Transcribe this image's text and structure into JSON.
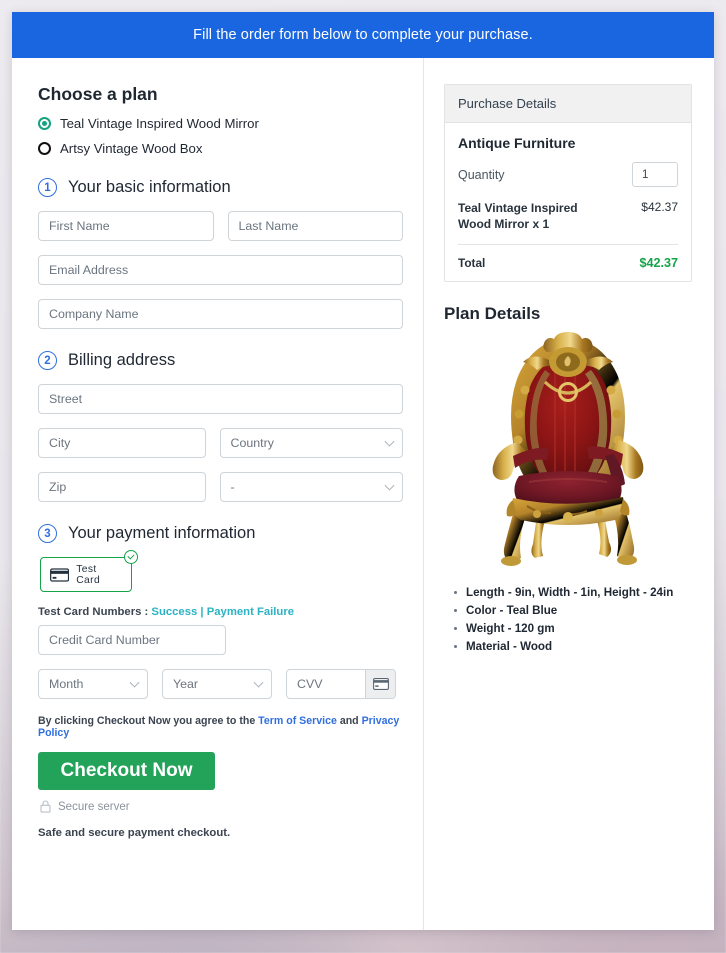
{
  "banner": {
    "text": "Fill the order form below to complete your purchase."
  },
  "plan": {
    "heading": "Choose a plan",
    "options": [
      {
        "label": "Teal Vintage Inspired Wood Mirror",
        "selected": true
      },
      {
        "label": "Artsy Vintage Wood Box",
        "selected": false
      }
    ]
  },
  "steps": {
    "basic": {
      "number": "1",
      "title": "Your basic information"
    },
    "billing": {
      "number": "2",
      "title": "Billing address"
    },
    "payment": {
      "number": "3",
      "title": "Your payment information"
    }
  },
  "basic_fields": {
    "first_name": "First Name",
    "last_name": "Last Name",
    "email": "Email Address",
    "company": "Company Name"
  },
  "billing_fields": {
    "street": "Street",
    "city": "City",
    "country": "Country",
    "zip": "Zip",
    "state": "-"
  },
  "payment": {
    "card_option_label": "Test Card",
    "card_option_selected": true,
    "test_card_prefix": "Test Card Numbers : ",
    "test_card_success": "Success",
    "test_card_separator": " | ",
    "test_card_failure": "Payment Failure",
    "credit_card_number": "Credit Card Number",
    "month": "Month",
    "year": "Year",
    "cvv": "CVV"
  },
  "terms": {
    "prefix": "By clicking Checkout Now you agree to the ",
    "tos": "Term of Service",
    "middle": " and ",
    "privacy": "Privacy Policy"
  },
  "actions": {
    "checkout": "Checkout Now",
    "secure_server": "Secure server",
    "safe_note": "Safe and secure payment checkout."
  },
  "purchase_details": {
    "header": "Purchase Details",
    "product_title": "Antique Furniture",
    "quantity_label": "Quantity",
    "quantity_value": "1",
    "line_item_name": "Teal Vintage Inspired Wood Mirror x 1",
    "line_item_price": "$42.37",
    "total_label": "Total",
    "total_value": "$42.37"
  },
  "plan_details": {
    "heading": "Plan Details",
    "image_alt": "antique-throne-chair",
    "specs": [
      "Length - 9in, Width - 1in, Height - 24in",
      "Color - Teal Blue",
      "Weight - 120 gm",
      "Material - Wood"
    ]
  },
  "colors": {
    "banner_blue": "#1a66e0",
    "accent_green": "#16a34a",
    "checkout_green": "#23a35a",
    "link_blue": "#2f6fe0",
    "link_teal": "#2bb2c4",
    "step_blue": "#2f6fe0"
  }
}
